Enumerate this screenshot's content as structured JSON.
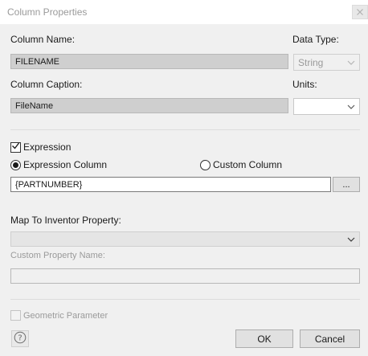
{
  "window": {
    "title": "Column Properties"
  },
  "column_name": {
    "label": "Column Name:",
    "value": "FILENAME"
  },
  "data_type": {
    "label": "Data Type:",
    "selected": "String"
  },
  "column_caption": {
    "label": "Column Caption:",
    "value": "FileName"
  },
  "units": {
    "label": "Units:",
    "selected": ""
  },
  "expression": {
    "checkbox_label": "Expression",
    "checked": true,
    "radio_expression_label": "Expression Column",
    "radio_custom_label": "Custom Column",
    "selected_radio": "Expression Column",
    "value": "{PARTNUMBER}",
    "browse_label": "..."
  },
  "map_to_inventor": {
    "label": "Map To Inventor Property:",
    "selected": "",
    "custom_property_label": "Custom Property Name:",
    "custom_property_value": ""
  },
  "geometric_parameter": {
    "label": "Geometric Parameter",
    "checked": false
  },
  "footer": {
    "help_icon_text": "?",
    "ok_label": "OK",
    "cancel_label": "Cancel"
  },
  "colors": {
    "dialog_bg": "#f0f0f0",
    "disabled_field_bg": "#cfcfcf",
    "button_bg": "#e1e1e1"
  },
  "icons": {
    "close": "close-icon",
    "dropdown": "chevron-down-icon",
    "help": "help-icon"
  }
}
